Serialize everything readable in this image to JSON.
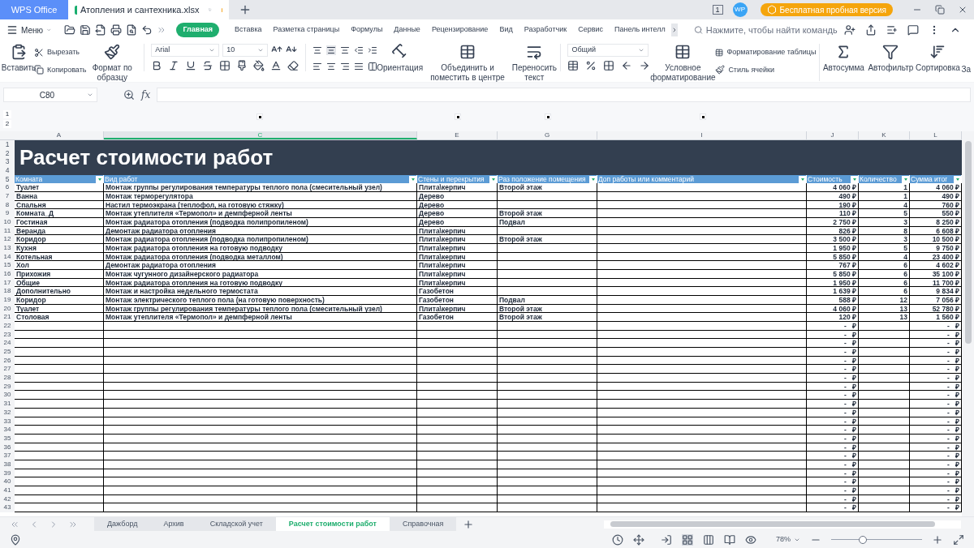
{
  "app": {
    "name": "WPS Office"
  },
  "doc_tab": {
    "title": "Атопления и сантехника.xlsx",
    "unsaved": true
  },
  "window": {
    "badge": "1",
    "avatar": "WP",
    "trial": "Бесплатная пробная версия"
  },
  "menu": "Меню",
  "ribbon_tabs": [
    {
      "label": "Главная",
      "selected": true
    },
    {
      "label": "Вставка",
      "selected": false
    },
    {
      "label": "Разметка страницы",
      "selected": false
    },
    {
      "label": "Формулы",
      "selected": false
    },
    {
      "label": "Данные",
      "selected": false
    },
    {
      "label": "Рецензирование",
      "selected": false
    },
    {
      "label": "Вид",
      "selected": false
    },
    {
      "label": "Разработчик",
      "selected": false
    },
    {
      "label": "Сервис",
      "selected": false
    },
    {
      "label": "Панель интелл",
      "selected": false
    }
  ],
  "search": {
    "placeholder": "Нажмите, чтобы найти команды"
  },
  "ribbon": {
    "paste": "Вставить",
    "cut": "Вырезать",
    "copy": "Копировать",
    "format_painter": "Формат по образцу",
    "font": "Arial",
    "size": "10",
    "orientation": "Ориентация",
    "merge": "Объединить и поместить в центре",
    "wrap": "Переносить текст",
    "number_format": "Общий",
    "conditional": "Условное форматирование",
    "table_format": "Форматирование таблицы",
    "cell_style": "Стиль ячейки",
    "autosum": "Автосумма",
    "autofilter": "Автофильтр",
    "sort": "Сортировка",
    "more": "За"
  },
  "formula_bar": {
    "cell_ref": "C80",
    "function_label": "fx"
  },
  "outline_levels": [
    "1",
    "2"
  ],
  "columns": [
    {
      "label": "A",
      "selected": false
    },
    {
      "label": "C",
      "selected": true
    },
    {
      "label": "E",
      "selected": false
    },
    {
      "label": "G",
      "selected": false
    },
    {
      "label": "I",
      "selected": false
    },
    {
      "label": "J",
      "selected": false
    },
    {
      "label": "K",
      "selected": false
    },
    {
      "label": "L",
      "selected": false
    }
  ],
  "title_rows": [
    "1",
    "2",
    "3",
    "4"
  ],
  "title": "Расчет стоимости работ",
  "header_row": "5",
  "headers": [
    "Комната",
    "Вид работ",
    "Стены и перекрытия",
    "Раз положение помещения",
    "Доп работы или комментарий",
    "Стоимость",
    "Количество",
    "Сумма итог"
  ],
  "rows": [
    {
      "n": "6",
      "cells": [
        "Туалет",
        "Монтаж группы регулирования температуры теплого пола (смесительный узел)",
        "Плита\\керпич",
        "Второй этаж",
        "",
        "4 060 ₽",
        "1",
        "4 060 ₽"
      ]
    },
    {
      "n": "7",
      "cells": [
        "Ванна",
        "Монтаж терморегулятора",
        "Дерево",
        "",
        "",
        "490 ₽",
        "1",
        "490 ₽"
      ]
    },
    {
      "n": "8",
      "cells": [
        "Спальня",
        "Настил термоэкрана (теплофол, на готовую стяжку)",
        "Дерево",
        "",
        "",
        "190 ₽",
        "4",
        "760 ₽"
      ]
    },
    {
      "n": "9",
      "cells": [
        "Комната_Д",
        "Монтаж утеплителя «Термопол» и демпферной ленты",
        "Дерево",
        "Второй этаж",
        "",
        "110 ₽",
        "5",
        "550 ₽"
      ]
    },
    {
      "n": "10",
      "cells": [
        "Гостиная",
        "Монтаж радиатора отопления (подводка полипропиленом)",
        "Дерево",
        "Подвал",
        "",
        "2 750 ₽",
        "3",
        "8 250 ₽"
      ]
    },
    {
      "n": "11",
      "cells": [
        "Веранда",
        "Демонтаж радиатора отопления",
        "Плита\\керпич",
        "",
        "",
        "826 ₽",
        "8",
        "6 608 ₽"
      ]
    },
    {
      "n": "12",
      "cells": [
        "Коридор",
        "Монтаж радиатора отопления (подводка полипропиленом)",
        "Плита\\керпич",
        "Второй этаж",
        "",
        "3 500 ₽",
        "3",
        "10 500 ₽"
      ]
    },
    {
      "n": "13",
      "cells": [
        "Кухня",
        "Монтаж радиатора отопления на готовую подводку",
        "Плита\\керпич",
        "",
        "",
        "1 950 ₽",
        "5",
        "9 750 ₽"
      ]
    },
    {
      "n": "14",
      "cells": [
        "Котельная",
        "Монтаж радиатора отопления (подводка металлом)",
        "Плита\\керпич",
        "",
        "",
        "5 850 ₽",
        "4",
        "23 400 ₽"
      ]
    },
    {
      "n": "15",
      "cells": [
        "Хол",
        "Демонтаж радиатора отопления",
        "Плита\\керпич",
        "",
        "",
        "767 ₽",
        "6",
        "4 602 ₽"
      ]
    },
    {
      "n": "16",
      "cells": [
        "Прихожия",
        "Монтаж чугунного дизайнерского радиатора",
        "Плита\\керпич",
        "",
        "",
        "5 850 ₽",
        "6",
        "35 100 ₽"
      ]
    },
    {
      "n": "17",
      "cells": [
        "Общие",
        "Монтаж радиатора отопления на готовую подводку",
        "Плита\\керпич",
        "",
        "",
        "1 950 ₽",
        "6",
        "11 700 ₽"
      ]
    },
    {
      "n": "18",
      "cells": [
        "Дополнительно",
        "Монтаж и настройка недельного термостата",
        "Газобетон",
        "",
        "",
        "1 639 ₽",
        "6",
        "9 834 ₽"
      ]
    },
    {
      "n": "19",
      "cells": [
        "Коридор",
        "Монтаж электрического теплого пола (на готовую поверхность)",
        "Газобетон",
        "Подвал",
        "",
        "588 ₽",
        "12",
        "7 056 ₽"
      ]
    },
    {
      "n": "20",
      "cells": [
        "Туалет",
        "Монтаж группы регулирования температуры теплого пола (смесительный узел)",
        "Плита\\керпич",
        "Второй этаж",
        "",
        "4 060 ₽",
        "13",
        "52 780 ₽"
      ]
    },
    {
      "n": "21",
      "cells": [
        "Столовая",
        "Монтаж утеплителя «Термопол» и демпферной ленты",
        "Газобетон",
        "Второй этаж",
        "",
        "120 ₽",
        "13",
        "1 560 ₽"
      ]
    },
    {
      "n": "22",
      "cells": [
        "",
        "",
        "",
        "",
        "",
        "-   ₽",
        "",
        "-   ₽"
      ]
    },
    {
      "n": "23",
      "cells": [
        "",
        "",
        "",
        "",
        "",
        "-   ₽",
        "",
        "-   ₽"
      ]
    },
    {
      "n": "24",
      "cells": [
        "",
        "",
        "",
        "",
        "",
        "-   ₽",
        "",
        "-   ₽"
      ]
    },
    {
      "n": "25",
      "cells": [
        "",
        "",
        "",
        "",
        "",
        "-   ₽",
        "",
        "-   ₽"
      ]
    },
    {
      "n": "26",
      "cells": [
        "",
        "",
        "",
        "",
        "",
        "-   ₽",
        "",
        "-   ₽"
      ]
    },
    {
      "n": "27",
      "cells": [
        "",
        "",
        "",
        "",
        "",
        "-   ₽",
        "",
        "-   ₽"
      ]
    },
    {
      "n": "28",
      "cells": [
        "",
        "",
        "",
        "",
        "",
        "-   ₽",
        "",
        "-   ₽"
      ]
    },
    {
      "n": "29",
      "cells": [
        "",
        "",
        "",
        "",
        "",
        "-   ₽",
        "",
        "-   ₽"
      ]
    },
    {
      "n": "30",
      "cells": [
        "",
        "",
        "",
        "",
        "",
        "-   ₽",
        "",
        "-   ₽"
      ]
    },
    {
      "n": "31",
      "cells": [
        "",
        "",
        "",
        "",
        "",
        "-   ₽",
        "",
        "-   ₽"
      ]
    },
    {
      "n": "32",
      "cells": [
        "",
        "",
        "",
        "",
        "",
        "-   ₽",
        "",
        "-   ₽"
      ]
    },
    {
      "n": "33",
      "cells": [
        "",
        "",
        "",
        "",
        "",
        "-   ₽",
        "",
        "-   ₽"
      ]
    },
    {
      "n": "34",
      "cells": [
        "",
        "",
        "",
        "",
        "",
        "-   ₽",
        "",
        "-   ₽"
      ]
    },
    {
      "n": "35",
      "cells": [
        "",
        "",
        "",
        "",
        "",
        "-   ₽",
        "",
        "-   ₽"
      ]
    },
    {
      "n": "36",
      "cells": [
        "",
        "",
        "",
        "",
        "",
        "-   ₽",
        "",
        "-   ₽"
      ]
    },
    {
      "n": "37",
      "cells": [
        "",
        "",
        "",
        "",
        "",
        "-   ₽",
        "",
        "-   ₽"
      ]
    },
    {
      "n": "38",
      "cells": [
        "",
        "",
        "",
        "",
        "",
        "-   ₽",
        "",
        "-   ₽"
      ]
    },
    {
      "n": "39",
      "cells": [
        "",
        "",
        "",
        "",
        "",
        "-   ₽",
        "",
        "-   ₽"
      ]
    },
    {
      "n": "40",
      "cells": [
        "",
        "",
        "",
        "",
        "",
        "-   ₽",
        "",
        "-   ₽"
      ]
    },
    {
      "n": "41",
      "cells": [
        "",
        "",
        "",
        "",
        "",
        "-   ₽",
        "",
        "-   ₽"
      ]
    },
    {
      "n": "42",
      "cells": [
        "",
        "",
        "",
        "",
        "",
        "-   ₽",
        "",
        "-   ₽"
      ]
    },
    {
      "n": "43",
      "cells": [
        "",
        "",
        "",
        "",
        "",
        "-   ₽",
        "",
        "-   ₽"
      ]
    }
  ],
  "sheet_tabs": [
    {
      "label": "Дажборд",
      "selected": false
    },
    {
      "label": "Архив",
      "selected": false
    },
    {
      "label": "Складской учет",
      "selected": false
    },
    {
      "label": "Расчет стоимости работ",
      "selected": true
    },
    {
      "label": "Справочная",
      "selected": false
    }
  ],
  "zoom": {
    "value": "78%",
    "level": 0.35
  }
}
